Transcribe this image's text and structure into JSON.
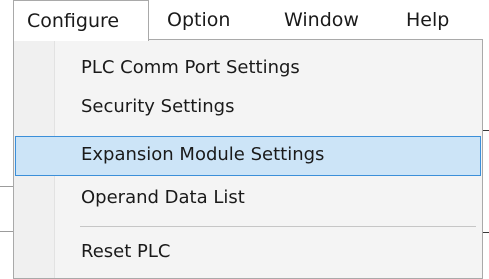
{
  "menubar": {
    "items": [
      {
        "label": "Configure"
      },
      {
        "label": "Option"
      },
      {
        "label": "Window"
      },
      {
        "label": "Help"
      }
    ]
  },
  "dropdown": {
    "items": [
      {
        "label": "PLC Comm Port Settings"
      },
      {
        "label": "Security Settings"
      },
      {
        "label": "Expansion Module Settings"
      },
      {
        "label": "Operand Data List"
      },
      {
        "label": "Reset PLC"
      }
    ],
    "highlighted_index": 2
  },
  "colors": {
    "highlight_fill": "#cce4f7",
    "highlight_border": "#3b8fd9",
    "menu_background": "#f4f4f4"
  }
}
